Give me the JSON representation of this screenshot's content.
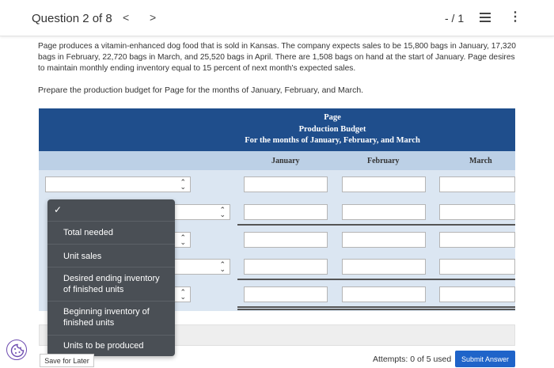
{
  "header": {
    "question_label": "Question 2 of 8",
    "prev_glyph": "<",
    "next_glyph": ">",
    "score": "- / 1",
    "kebab_glyph": "⋮"
  },
  "problem_text": "Page produces a vitamin-enhanced dog food that is sold in Kansas. The company expects sales to be 15,800 bags in January, 17,320 bags in February, 22,720 bags in March, and 25,520 bags in April. There are 1,508 bags on hand at the start of January. Page desires to maintain monthly ending inventory equal to 15 percent of next month's expected sales.",
  "prompt_text": "Prepare the production budget for Page for the months of January, February, and March.",
  "table": {
    "company": "Page",
    "budget_title": "Production Budget",
    "period": "For the months of January, February, and March",
    "columns": [
      "January",
      "February",
      "March"
    ]
  },
  "dropdown": {
    "check_glyph": "✓",
    "options": [
      "Total needed",
      "Unit sales",
      "Desired ending inventory of finished units",
      "Beginning inventory of finished units",
      "Units to be produced"
    ]
  },
  "footer": {
    "save_label": "Save for Later",
    "attempts": "Attempts: 0 of 5 used",
    "submit_label": "Submit Answer"
  },
  "colors": {
    "table_header": "#1f4e8c",
    "column_header": "#bcd0e6",
    "table_body": "#dbe6f2",
    "dropdown_bg": "#4a4f55",
    "submit": "#1f64c9"
  }
}
